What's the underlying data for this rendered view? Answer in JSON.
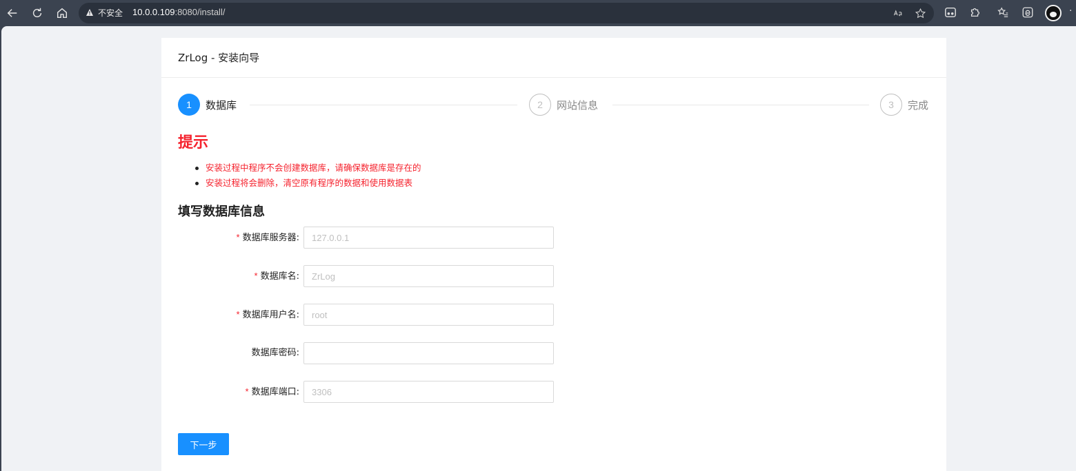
{
  "browser": {
    "security_label": "不安全",
    "url_host": "10.0.0.109",
    "url_rest": ":8080/install/"
  },
  "page": {
    "title": "ZrLog - 安装向导",
    "steps": [
      {
        "number": "1",
        "label": "数据库",
        "state": "active"
      },
      {
        "number": "2",
        "label": "网站信息",
        "state": "wait"
      },
      {
        "number": "3",
        "label": "完成",
        "state": "wait"
      }
    ],
    "tips": {
      "title": "提示",
      "items": [
        "安装过程中程序不会创建数据库，请确保数据库是存在的",
        "安装过程将会删除，清空原有程序的数据和使用数据表"
      ]
    },
    "section_title": "填写数据库信息",
    "form": {
      "fields": [
        {
          "label": "数据库服务器:",
          "required": true,
          "placeholder": "127.0.0.1",
          "value": ""
        },
        {
          "label": "数据库名:",
          "required": true,
          "placeholder": "ZrLog",
          "value": ""
        },
        {
          "label": "数据库用户名:",
          "required": true,
          "placeholder": "root",
          "value": ""
        },
        {
          "label": "数据库密码:",
          "required": false,
          "placeholder": "",
          "value": ""
        },
        {
          "label": "数据库端口:",
          "required": true,
          "placeholder": "3306",
          "value": ""
        }
      ],
      "required_mark": "*",
      "next_label": "下一步"
    },
    "colors": {
      "primary": "#1890ff",
      "danger": "#f5222d"
    }
  }
}
